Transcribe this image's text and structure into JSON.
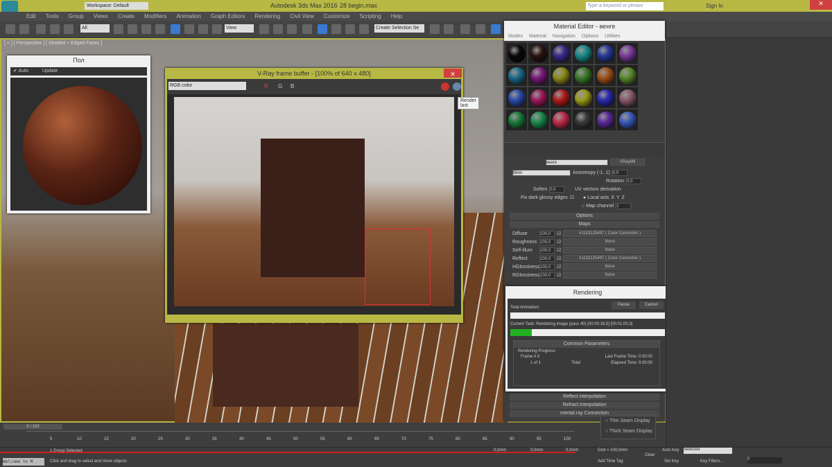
{
  "app": {
    "title": "Autodesk 3ds Max 2016",
    "file": "28 begin.max",
    "workspace": "Workspace: Default",
    "search_placeholder": "Type a keyword or phrase",
    "sign_in": "Sign In"
  },
  "menu": [
    "Edit",
    "Tools",
    "Group",
    "Views",
    "Create",
    "Modifiers",
    "Animation",
    "Graph Editors",
    "Rendering",
    "Civil View",
    "Customize",
    "Scripting",
    "Help"
  ],
  "toolbar": {
    "filter": "All",
    "coord": "View",
    "selection_set": "Create Selection Se"
  },
  "viewport": {
    "label": "[ + ] [ Perspective ] [ Shaded + Edged Faces ]"
  },
  "preview_window": {
    "title": "Пол",
    "auto_label": "Auto",
    "update_label": "Update"
  },
  "vfb": {
    "title": "V-Ray frame buffer - [100% of 640 x 480]",
    "channel": "RGB color",
    "r": "R",
    "g": "G",
    "b": "B",
    "tooltip": "Render last"
  },
  "material_editor": {
    "title": "Material Editor - венге",
    "menus": [
      "Modes",
      "Material",
      "Navigation",
      "Options",
      "Utilities"
    ],
    "material_name": "венге",
    "material_type": "VRayMtl",
    "sphere_colors": [
      "#0a0a0a",
      "#2a1410",
      "#3a2a8a",
      "#1a8a8a",
      "#2a3a9a",
      "#7a3a9a",
      "#1a6a8a",
      "#7a1a7a",
      "#8a8a1a",
      "#3a7a2a",
      "#a0501a",
      "#5a8a2a",
      "#2a4aaa",
      "#9a1a5a",
      "#b01a1a",
      "#9a9a1a",
      "#2a2ab0",
      "#8a5a6a",
      "#1a7a3a",
      "#1a8a4a",
      "#c02a4a",
      "#3a3a3a",
      "#5a2a9a",
      "#3a5aba"
    ],
    "brdf": "Blinn",
    "anisotropy_label": "Anisotropy (-1..1)",
    "anisotropy": "0,0",
    "rotation_label": "Rotation",
    "rotation": "0,0",
    "soften_label": "Soften",
    "soften": "0,0",
    "fix_dark_label": "Fix dark glossy edges",
    "uv_group": "UV vectors derivation",
    "local_axis": "Local axis",
    "axes": [
      "X",
      "Y",
      "Z"
    ],
    "map_channel_label": "Map channel",
    "map_channel": "1",
    "rollouts": {
      "options": "Options",
      "maps": "Maps"
    },
    "maps": [
      {
        "name": "Diffuse",
        "amount": "100,0",
        "map": "#1123125497 ( Color Correction )"
      },
      {
        "name": "Roughness",
        "amount": "100,0",
        "map": "None"
      },
      {
        "name": "Self-illum",
        "amount": "100,0",
        "map": "None"
      },
      {
        "name": "Reflect",
        "amount": "100,0",
        "map": "#1123125497 ( Color Correction )"
      },
      {
        "name": "HGlossiness",
        "amount": "100,0",
        "map": "None"
      },
      {
        "name": "RGlossiness",
        "amount": "100,0",
        "map": "None"
      }
    ],
    "lower_rollouts": [
      "Reflect interpolation",
      "Refract interpolation",
      "mental ray Connection"
    ]
  },
  "rendering": {
    "title": "Rendering",
    "total_label": "Total Animation:",
    "pause": "Pause",
    "cancel": "Cancel",
    "current_task_label": "Current Task:",
    "current_task": "Rendering image (pass 40) [00:00:16,5] [00:01:00,3]",
    "progress_pct": 14,
    "progress_color": "#22b022",
    "common_params": "Common Parameters",
    "rendering_progress": "Rendering Progress:",
    "frame_label": "Frame #",
    "frame": "0",
    "of": "1 of 1",
    "total": "Total",
    "last_frame_label": "Last Frame Time:",
    "last_frame": "0:00:00",
    "elapsed_label": "Elapsed Time:",
    "elapsed": "0:00:00"
  },
  "cmdpanel": {
    "thin_seam": "Thin Seam Display",
    "thick_seam": "Thick Seam Display"
  },
  "timeline": {
    "frame": "0 / 100",
    "ticks": [
      "5",
      "10",
      "15",
      "20",
      "25",
      "30",
      "35",
      "40",
      "45",
      "50",
      "55",
      "60",
      "65",
      "70",
      "75",
      "80",
      "85",
      "90",
      "95",
      "100"
    ]
  },
  "status": {
    "welcome": "Welcome to M",
    "selected": "1 Group Selected",
    "hint": "Click and drag to select and move objects",
    "x": "0,0mm",
    "y": "0,0mm",
    "z": "0,0mm",
    "grid": "Grid = 100,0mm",
    "auto_key": "Auto Key",
    "key_mode": "Selected",
    "set_key": "Set Key",
    "key_filters": "Key Filters...",
    "add_time_tag": "Add Time Tag",
    "clear": "Clear",
    "frame_field": "0"
  }
}
